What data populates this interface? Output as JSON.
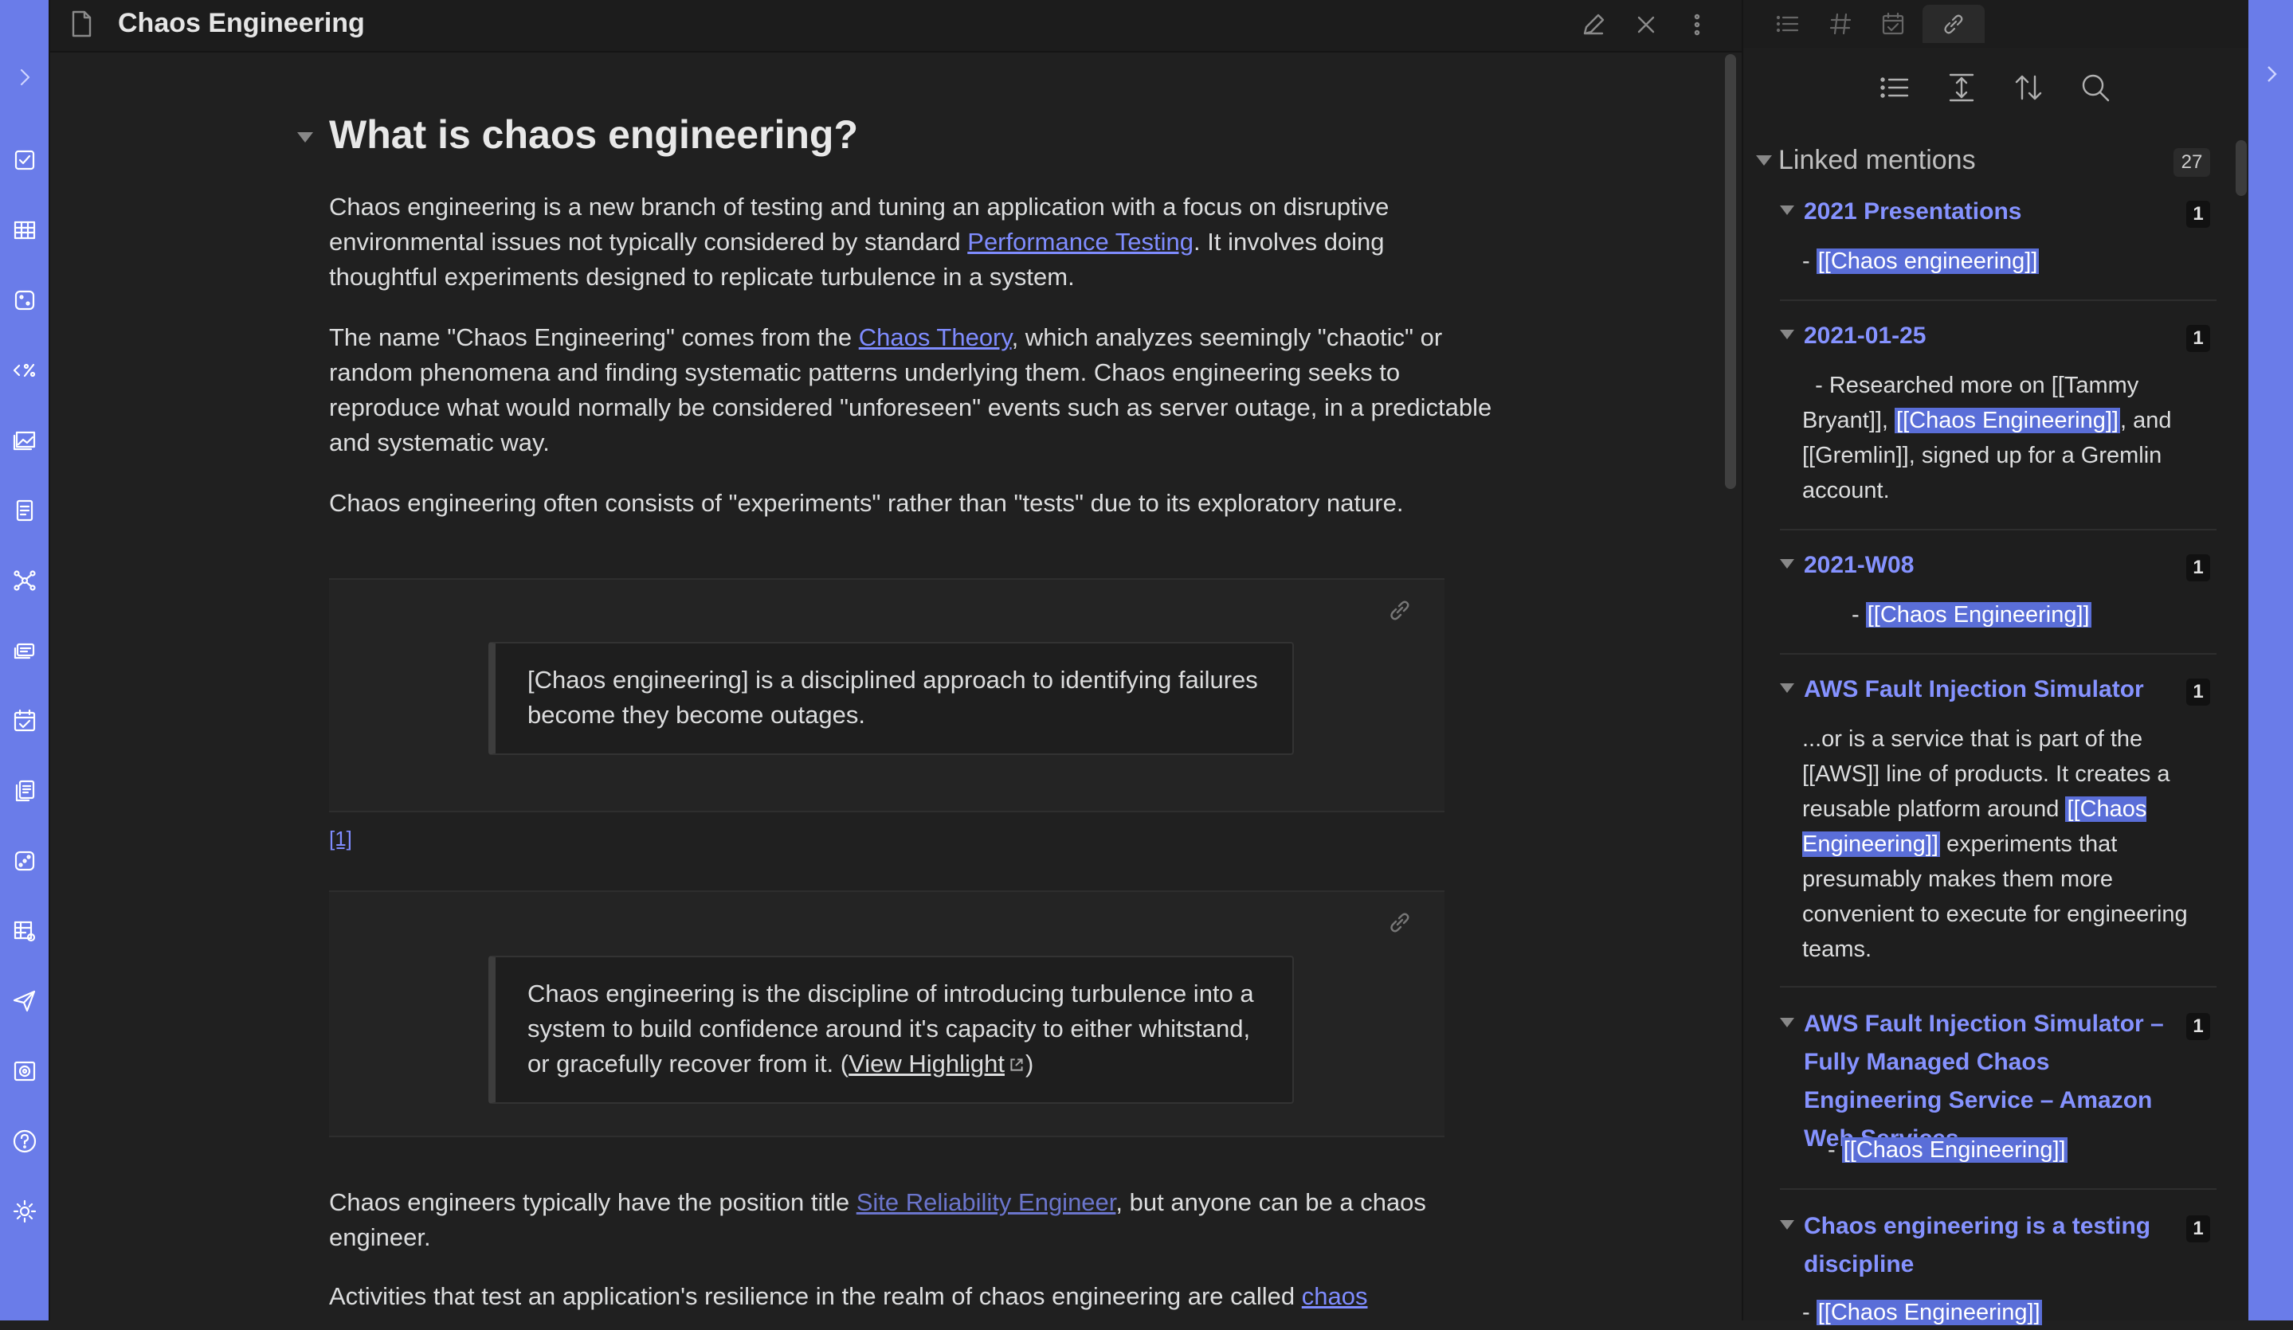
{
  "window": {
    "title": "Chaos Engineering"
  },
  "ribbon": {
    "icons": [
      "chevron-right-icon",
      "checkbox-icon",
      "table-icon",
      "dice-icon",
      "percent-code-icon",
      "gallery-icon",
      "note-list-icon",
      "graph-icon",
      "cards-icon",
      "calendar-check-icon",
      "documents-icon",
      "dice-alt-icon",
      "table-settings-icon",
      "send-icon",
      "vault-icon",
      "help-icon",
      "settings-icon"
    ]
  },
  "editor": {
    "heading": "What is chaos engineering?",
    "p1": {
      "t1": "Chaos engineering is a new branch of testing and tuning an application with a focus on disruptive environmental issues not typically considered by standard ",
      "link": "Performance Testing",
      "t2": ". It involves doing thoughtful experiments designed to replicate turbulence in a system."
    },
    "p2": {
      "t1": "The name \"Chaos Engineering\" comes from the ",
      "link": "Chaos Theory",
      "t2": ", which analyzes seemingly \"chaotic\" or random phenomena and finding systematic patterns underlying them. Chaos engineering seeks to reproduce what would normally be considered \"unforeseen\" events such as server outage, in a predictable and systematic way."
    },
    "p3": "Chaos engineering often consists of \"experiments\" rather than \"tests\" due to its exploratory nature.",
    "quote1": "[Chaos engineering] is a disciplined approach to identifying failures become they become outages.",
    "footnote": "[1]",
    "quote2": {
      "text": "Chaos engineering is the discipline of introducing turbulence into a system to build confidence around it's capacity to either whitstand, or gracefully recover from it. (",
      "link": "View Highlight",
      "end": ")"
    },
    "p4": {
      "t1": "Chaos engineers typically have the position title ",
      "link": "Site Reliability Engineer",
      "t2": ", but anyone can be a chaos engineer."
    },
    "p5": {
      "t1": "Activities that test an application's resilience in the realm of chaos engineering are called ",
      "link": "chaos"
    }
  },
  "backlinks": {
    "header": "Linked mentions",
    "count": "27",
    "mentions": [
      {
        "title": "2021 Presentations",
        "count": "1",
        "pre": "- ",
        "hl": "[[Chaos engineering]]",
        "post": ""
      },
      {
        "title": "2021-01-25",
        "count": "1",
        "pre": "  - Researched more on [[Tammy Bryant]], ",
        "hl": "[[Chaos Engineering]]",
        "post": ", and [[Gremlin]], signed up for a Gremlin account."
      },
      {
        "title": "2021-W08",
        "count": "1",
        "pre": "- ",
        "hl": "[[Chaos Engineering]]",
        "post": ""
      },
      {
        "title": "AWS Fault Injection Simulator",
        "count": "1",
        "pre": "...or is a service that is part of the [[AWS]] line of products. It creates a reusable platform around ",
        "hl": "[[Chaos Engineering]]",
        "post": " experiments that presumably makes them more convenient to execute for engineering teams."
      },
      {
        "title": "AWS Fault Injection Simulator – Fully Managed Chaos Engineering Service – Amazon Web Services",
        "count": "1",
        "pre": "- ",
        "hl": "[[Chaos Engineering]]",
        "post": ""
      },
      {
        "title": "Chaos engineering is a testing discipline",
        "count": "1",
        "pre": "- ",
        "hl": "[[Chaos Engineering]]",
        "post": ""
      }
    ]
  },
  "colors": {
    "accent": "#6a7ce9",
    "link": "#7f8cff",
    "highlight": "#5a6ed8"
  }
}
